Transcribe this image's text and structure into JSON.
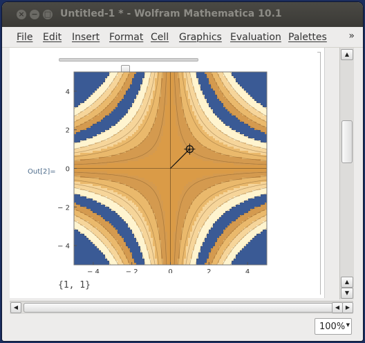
{
  "window": {
    "title": "Untitled-1 * - Wolfram Mathematica 10.1",
    "controls": {
      "close": "×",
      "minimize": "−",
      "maximize": "□"
    }
  },
  "menubar": {
    "items": [
      "File",
      "Edit",
      "Insert",
      "Format",
      "Cell",
      "Graphics",
      "Evaluation",
      "Palettes"
    ],
    "overflow": "»"
  },
  "notebook": {
    "manipulate_slider_value": 0.5,
    "output_label": "Out[2]=",
    "result": "{1, 1}"
  },
  "chart_data": {
    "type": "contour",
    "function": "x*y",
    "x_range": [
      -5,
      5
    ],
    "y_range": [
      -5,
      5
    ],
    "x_ticks": [
      -4,
      -2,
      0,
      2,
      4
    ],
    "y_ticks": [
      4,
      2,
      0,
      -2,
      -4
    ],
    "x_tick_labels": [
      "− 4",
      "− 2",
      "0",
      "2",
      "4"
    ],
    "y_tick_labels": [
      "4",
      "2",
      "0",
      "− 2",
      "− 4"
    ],
    "locator_point": [
      1,
      1
    ],
    "colors": {
      "dark_blue": "#3a5a95",
      "deep_gold": "#d49a4f",
      "light_gold": "#eab96c",
      "pale_gold": "#f6d59a",
      "cream": "#fff4cf",
      "center_orange": "#da9b47"
    }
  },
  "statusbar": {
    "zoom": "100%"
  }
}
